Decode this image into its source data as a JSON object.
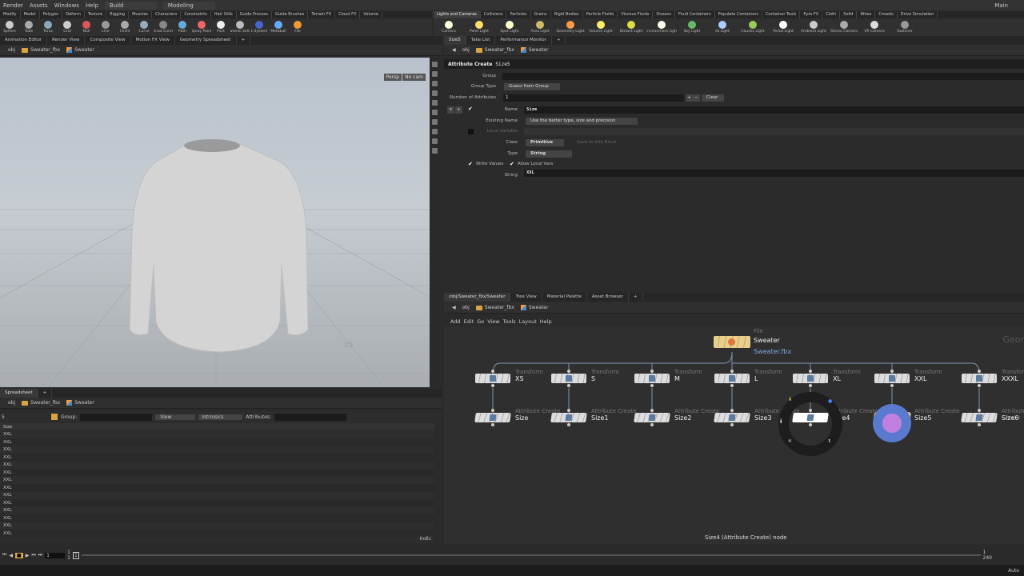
{
  "menu": {
    "items": [
      "Render",
      "Assets",
      "Windows",
      "Help"
    ],
    "desktop": "Build",
    "context": "Modeling",
    "main": "Main"
  },
  "shelf_left": {
    "tabs": [
      "Modify",
      "Model",
      "Polygon",
      "Deform",
      "Texture",
      "Rigging",
      "Muscles",
      "Characters",
      "Constraints",
      "Hair Utils",
      "Guide Process",
      "Guide Brushes",
      "Terrain FX",
      "Cloud FX",
      "Volume"
    ],
    "tools": [
      "Sphere",
      "Tube",
      "Torus",
      "Grid",
      "Null",
      "Line",
      "Circle",
      "Curve",
      "Draw Curve",
      "Path",
      "Spray Paint",
      "Font",
      "Platonic Solids",
      "L-System",
      "Metaball",
      "File"
    ]
  },
  "shelf_right": {
    "tabs": [
      "Lights and Cameras",
      "Collisions",
      "Particles",
      "Grains",
      "Rigid Bodies",
      "Particle Fluids",
      "Viscous Fluids",
      "Oceans",
      "Fluid Containers",
      "Populate Containers",
      "Container Tools",
      "Pyro FX",
      "Cloth",
      "Solid",
      "Wires",
      "Crowds",
      "Drive Simulation"
    ],
    "tools": [
      "Camera",
      "Point Light",
      "Spot Light",
      "Area Light",
      "Geometry Light",
      "Volume Light",
      "Distant Light",
      "Environment Light",
      "Sky Light",
      "GI Light",
      "Caustic Light",
      "Portal Light",
      "Ambient Light",
      "Stereo Camera",
      "VR Camera",
      "Switcher"
    ]
  },
  "left_pane": {
    "tabs": [
      "Animation Editor",
      "Render View",
      "Composite View",
      "Motion FX View",
      "Geometry Spreadsheet"
    ],
    "path": [
      "obj",
      "Sweater_fbx",
      "Sweater"
    ],
    "persp": "Persp",
    "cam": "No cam",
    "grid_label": "25"
  },
  "right_pane": {
    "tabs": [
      "Size5",
      "Take List",
      "Performance Monitor"
    ],
    "path": [
      "obj",
      "Sweater_fbx",
      "Sweater"
    ]
  },
  "params": {
    "node_type": "Attribute Create",
    "node_name": "Size5",
    "group_label": "Group",
    "group_value": "",
    "group_type_label": "Group Type",
    "group_type": "Guess from Group",
    "num_attr_label": "Number of Attributes",
    "num_attr": "1",
    "clear": "Clear",
    "name_label": "Name",
    "name": "Size",
    "existing_label": "Existing Name",
    "existing": "Use the better type, size and precision",
    "local_var_label": "Local Variable",
    "class_label": "Class",
    "class": "Primitive",
    "save_info": "Save to Info Block",
    "type_label": "Type",
    "type": "String",
    "write_values": "Write Values",
    "allow_local": "Allow Local Vars",
    "string_label": "String",
    "string": "XXL"
  },
  "spreadsheet": {
    "tab": "Spreadsheet",
    "path": [
      "obj",
      "Sweater_fbx",
      "Sweater"
    ],
    "count": "5",
    "group_label": "Group:",
    "view": "View",
    "intrinsics": "Intrinsics",
    "attributes_label": "Attributes:",
    "column": "Size",
    "rows": [
      "XXL",
      "XXL",
      "XXL",
      "XXL",
      "XXL",
      "XXL",
      "XXL",
      "XXL",
      "XXL",
      "XXL",
      "XXL",
      "XXL",
      "XXL",
      "XXL"
    ],
    "footer": "Indic"
  },
  "network": {
    "tabs": [
      "/obj/Sweater_fbx/Sweater",
      "Tree View",
      "Material Palette",
      "Asset Browser"
    ],
    "path": [
      "obj",
      "Sweater_fbx",
      "Sweater"
    ],
    "menu": [
      "Add",
      "Edit",
      "Go",
      "View",
      "Tools",
      "Layout",
      "Help"
    ],
    "context_label": "Geor",
    "file_node": {
      "type": "File",
      "name": "Sweater",
      "file": "Sweater.fbx"
    },
    "transforms": [
      {
        "type": "Transform",
        "name": "XS"
      },
      {
        "type": "Transform",
        "name": "S"
      },
      {
        "type": "Transform",
        "name": "M"
      },
      {
        "type": "Transform",
        "name": "L"
      },
      {
        "type": "Transform",
        "name": "XL"
      },
      {
        "type": "Transform",
        "name": "XXL"
      },
      {
        "type": "Transform",
        "name": "XXXL"
      }
    ],
    "attribs": [
      {
        "type": "Attribute Create",
        "name": "Size"
      },
      {
        "type": "Attribute Create",
        "name": "Size1"
      },
      {
        "type": "Attribute Create",
        "name": "Size2"
      },
      {
        "type": "Attribute Create",
        "name": "Size3"
      },
      {
        "type": "Attribute Create",
        "name": "Size4"
      },
      {
        "type": "Attribute Create",
        "name": "Size5"
      },
      {
        "type": "Attribute Create",
        "name": "Size6"
      }
    ],
    "info_icon": "i",
    "status": "Size4 (Attribute Create) node"
  },
  "timeline": {
    "frame": "1",
    "start": "1",
    "start2": "1",
    "end": "240",
    "end_top": "1",
    "marker": "1",
    "auto": "Auto"
  }
}
